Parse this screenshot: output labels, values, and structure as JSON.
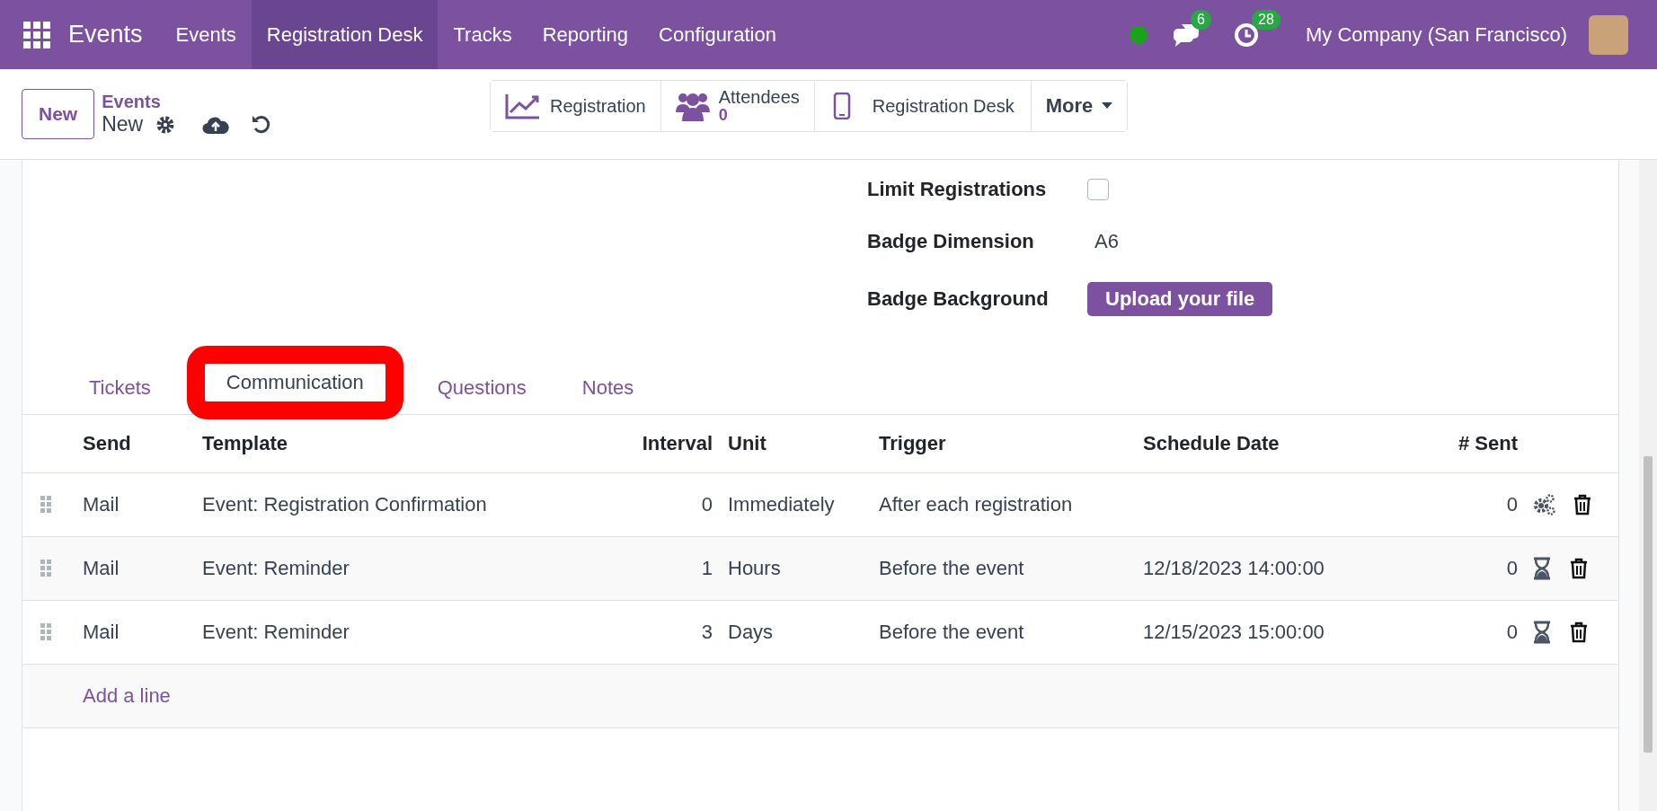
{
  "navbar": {
    "app_name": "Events",
    "menu": [
      {
        "label": "Events",
        "selected": false
      },
      {
        "label": "Registration Desk",
        "selected": true
      },
      {
        "label": "Tracks",
        "selected": false
      },
      {
        "label": "Reporting",
        "selected": false
      },
      {
        "label": "Configuration",
        "selected": false
      }
    ],
    "messages_count": "6",
    "activities_count": "28",
    "company": "My Company (San Francisco)"
  },
  "control_panel": {
    "new_button": "New",
    "breadcrumb": "Events",
    "record_name": "New",
    "smart_buttons": [
      {
        "kind": "chart",
        "label": "Registration"
      },
      {
        "kind": "people",
        "label": "Attendees",
        "value": "0"
      },
      {
        "kind": "phone",
        "label": "Registration Desk"
      },
      {
        "kind": "more",
        "label": "More"
      }
    ]
  },
  "fields": [
    {
      "kind": "checkbox",
      "label": "Limit Registrations",
      "checked": false
    },
    {
      "kind": "text",
      "label": "Badge Dimension",
      "value": "A6"
    },
    {
      "kind": "upload",
      "label": "Badge Background",
      "value": "Upload your file"
    }
  ],
  "tabs": [
    {
      "label": "Tickets",
      "selected": false,
      "highlighted": false
    },
    {
      "label": "Communication",
      "selected": true,
      "highlighted": true
    },
    {
      "label": "Questions",
      "selected": false,
      "highlighted": false
    },
    {
      "label": "Notes",
      "selected": false,
      "highlighted": false
    }
  ],
  "table": {
    "columns": [
      "Send",
      "Template",
      "Interval",
      "Unit",
      "Trigger",
      "Schedule Date",
      "# Sent"
    ],
    "rows": [
      {
        "send": "Mail",
        "template": "Event: Registration Confirmation",
        "interval": "0",
        "unit": "Immediately",
        "trigger": "After each registration",
        "sent": "0",
        "kind": "gears"
      },
      {
        "send": "Mail",
        "template": "Event: Reminder",
        "interval": "1",
        "unit": "Hours",
        "trigger": "Before the event",
        "schedule_date": "12/18/2023 14:00:00",
        "sent": "0",
        "kind": "hourglass"
      },
      {
        "send": "Mail",
        "template": "Event: Reminder",
        "interval": "3",
        "unit": "Days",
        "trigger": "Before the event",
        "schedule_date": "12/15/2023 15:00:00",
        "sent": "0",
        "kind": "hourglass"
      }
    ],
    "add_line": "Add a line"
  }
}
